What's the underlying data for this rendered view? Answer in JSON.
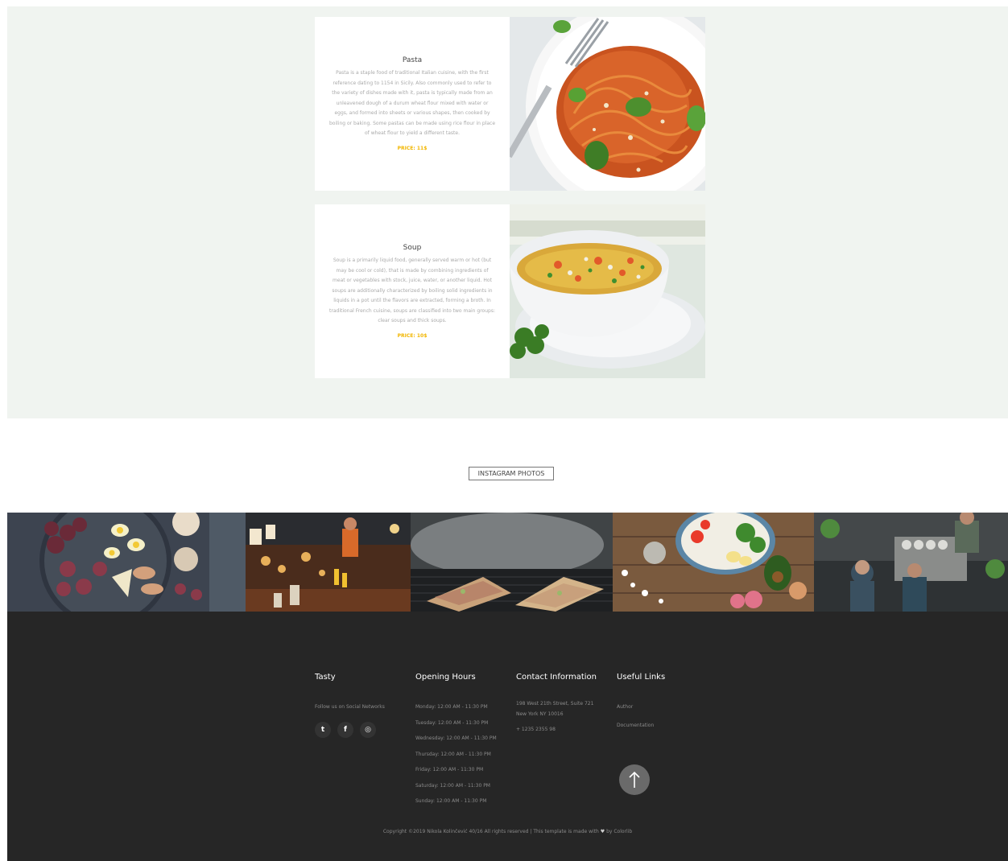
{
  "menu": {
    "items": [
      {
        "title": "Pasta",
        "description": "Pasta is a staple food of traditional Italian cuisine, with the first reference dating to 1154 in Sicily. Also commonly used to refer to the variety of dishes made with it, pasta is typically made from an unleavened dough of a durum wheat flour mixed with water or eggs, and formed into sheets or various shapes, then cooked by boiling or baking. Some pastas can be made using rice flour in place of wheat flour to yield a different taste.",
        "price": "PRICE: 11$"
      },
      {
        "title": "Soup",
        "description": "Soup is a primarily liquid food, generally served warm or hot (but may be cool or cold), that is made by combining ingredients of meat or vegetables with stock, juice, water, or another liquid. Hot soups are additionally characterized by boiling solid ingredients in liquids in a pot until the flavors are extracted, forming a broth. In traditional French cuisine, soups are classified into two main groups: clear soups and thick soups.",
        "price": "PRICE: 10$"
      }
    ]
  },
  "instagram": {
    "label": "INSTAGRAM PHOTOS"
  },
  "footer": {
    "tasty": {
      "title": "Tasty",
      "follow": "Follow us on Social Networks",
      "social": [
        {
          "icon": "twitter-icon",
          "glyph": "t"
        },
        {
          "icon": "facebook-icon",
          "glyph": "f"
        },
        {
          "icon": "instagram-icon",
          "glyph": "◎"
        }
      ]
    },
    "hours": {
      "title": "Opening Hours",
      "days": [
        "Monday: 12:00 AM - 11:30 PM",
        "Tuesday: 12:00 AM - 11:30 PM",
        "Wednesday: 12:00 AM - 11:30 PM",
        "Thursday: 12:00 AM - 11:30 PM",
        "Friday: 12:00 AM - 11:30 PM",
        "Saturday: 12:00 AM - 11:30 PM",
        "Sunday: 12:00 AM - 11:30 PM"
      ]
    },
    "contact": {
      "title": "Contact Information",
      "address_line1": "198 West 21th Street, Suite 721",
      "address_line2": "New York NY 10016",
      "phone": "+ 1235 2355 98"
    },
    "links": {
      "title": "Useful Links",
      "items": [
        "Author",
        "Documentation"
      ]
    },
    "copyright_pre": "Copyright ©2019 Nikola Kolinčević 40/16 All rights reserved | This template is made with",
    "copyright_post": "by Colorlib"
  },
  "colors": {
    "accent": "#f2b600",
    "footer_bg": "#262626",
    "menu_bg": "#f0f4f0"
  }
}
